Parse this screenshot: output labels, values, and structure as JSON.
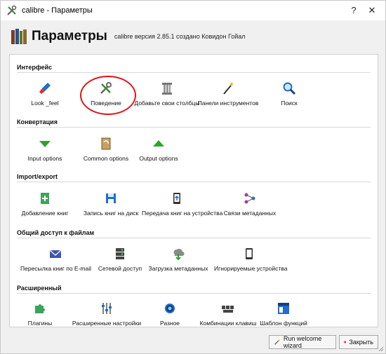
{
  "window": {
    "title": "calibre - Параметры",
    "help_label": "?",
    "close_label": "✕"
  },
  "header": {
    "heading": "Параметры",
    "version": "calibre версия 2.85.1 создано Ковидон Гойал"
  },
  "sections": [
    {
      "title": "Интерфейс",
      "items": [
        {
          "label": "Look _feel",
          "icon": "paintbrush-icon"
        },
        {
          "label": "Поведение",
          "icon": "tools-icon"
        },
        {
          "label": "Добавьте свои столбцы",
          "icon": "column-icon"
        },
        {
          "label": "Панели инструментов",
          "icon": "magic-wand-icon"
        },
        {
          "label": "Поиск",
          "icon": "search-icon"
        }
      ]
    },
    {
      "title": "Конвертация",
      "items": [
        {
          "label": "Input options",
          "icon": "arrow-down-icon"
        },
        {
          "label": "Common options",
          "icon": "document-convert-icon"
        },
        {
          "label": "Output options",
          "icon": "arrow-up-icon"
        }
      ]
    },
    {
      "title": "Import/export",
      "items": [
        {
          "label": "Добавление книг",
          "icon": "add-book-icon"
        },
        {
          "label": "Запись книг на диск",
          "icon": "save-disk-icon"
        },
        {
          "label": "Передача книг на устройства",
          "icon": "device-transfer-icon"
        },
        {
          "label": "Связи метаданных",
          "icon": "metadata-links-icon"
        }
      ]
    },
    {
      "title": "Общий доступ к файлам",
      "items": [
        {
          "label": "Пересылка книг по E-mail",
          "icon": "email-icon"
        },
        {
          "label": "Сетевой доступ",
          "icon": "server-icon"
        },
        {
          "label": "Загрузка метаданных",
          "icon": "cloud-download-icon"
        },
        {
          "label": "Игнорируемые устройства",
          "icon": "device-icon"
        }
      ]
    },
    {
      "title": "Расширенный",
      "items": [
        {
          "label": "Плагины",
          "icon": "puzzle-icon"
        },
        {
          "label": "Расширенные настройки",
          "icon": "sliders-icon"
        },
        {
          "label": "Разное",
          "icon": "gear-icon"
        },
        {
          "label": "Комбинации клавиш",
          "icon": "keyboard-icon"
        },
        {
          "label": "Шаблон функций",
          "icon": "template-icon"
        }
      ]
    }
  ],
  "buttons": {
    "wizard": "Run welcome wizard",
    "close": "Закрыть"
  },
  "colors": {
    "highlight_circle": "#e01515",
    "accent": "#1e6fc9"
  }
}
